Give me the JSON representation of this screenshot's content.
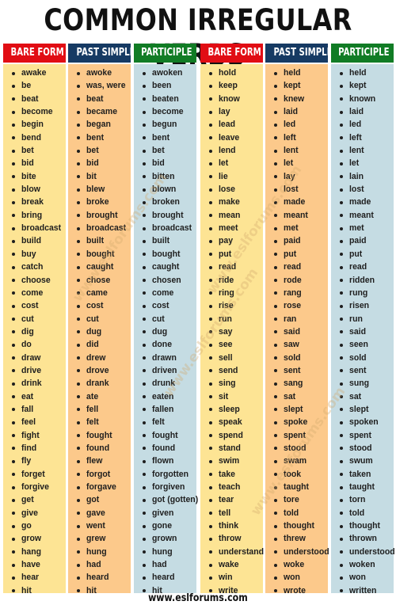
{
  "title": "COMMON IRREGULAR VERBS",
  "footer": "www.eslforums.com",
  "watermark": "www.eslforums.com",
  "colors": {
    "bare_header": "#e10d14",
    "past_header": "#163a63",
    "participle_header": "#117c25",
    "bare_bg": "#fde494",
    "past_bg": "#fcc98b",
    "participle_bg": "#c5dce3"
  },
  "columns": [
    {
      "header": "BARE FORM",
      "items": [
        "awake",
        "be",
        "beat",
        "become",
        "begin",
        "bend",
        "bet",
        "bid",
        "bite",
        "blow",
        "break",
        "bring",
        "broadcast",
        "build",
        "buy",
        "catch",
        "choose",
        "come",
        "cost",
        "cut",
        "dig",
        "do",
        "draw",
        "drive",
        "drink",
        "eat",
        "fall",
        "feel",
        "fight",
        "find",
        "fly",
        "forget",
        "forgive",
        "get",
        "give",
        "go",
        "grow",
        "hang",
        "have",
        "hear",
        "hit"
      ]
    },
    {
      "header": "PAST SIMPLE",
      "items": [
        "awoke",
        "was, were",
        "beat",
        "became",
        "began",
        "bent",
        "bet",
        "bid",
        "bit",
        "blew",
        "broke",
        "brought",
        "broadcast",
        "built",
        "bought",
        "caught",
        "chose",
        "came",
        "cost",
        "cut",
        "dug",
        "did",
        "drew",
        "drove",
        "drank",
        "ate",
        "fell",
        "felt",
        "fought",
        "found",
        "flew",
        "forgot",
        "forgave",
        "got",
        "gave",
        "went",
        "grew",
        "hung",
        "had",
        "heard",
        "hit"
      ]
    },
    {
      "header": "PARTICIPLE",
      "items": [
        "awoken",
        "been",
        "beaten",
        "become",
        "begun",
        "bent",
        "bet",
        "bid",
        "bitten",
        "blown",
        "broken",
        "brought",
        "broadcast",
        "built",
        "bought",
        "caught",
        "chosen",
        "come",
        "cost",
        "cut",
        "dug",
        "done",
        "drawn",
        "driven",
        "drunk",
        "eaten",
        "fallen",
        "felt",
        "fought",
        "found",
        "flown",
        "forgotten",
        "forgiven",
        "got (gotten)",
        "given",
        "gone",
        "grown",
        "hung",
        "had",
        "heard",
        "hit"
      ]
    },
    {
      "header": "BARE FORM",
      "items": [
        "hold",
        "keep",
        "know",
        "lay",
        "lead",
        "leave",
        "lend",
        "let",
        "lie",
        "lose",
        "make",
        "mean",
        "meet",
        "pay",
        "put",
        "read",
        "ride",
        "ring",
        "rise",
        "run",
        "say",
        "see",
        "sell",
        "send",
        "sing",
        "sit",
        "sleep",
        "speak",
        "spend",
        "stand",
        "swim",
        "take",
        "teach",
        "tear",
        "tell",
        "think",
        "throw",
        "understand",
        "wake",
        "win",
        "write"
      ]
    },
    {
      "header": "PAST SIMPLE",
      "items": [
        "held",
        "kept",
        "knew",
        "laid",
        "led",
        "left",
        "lent",
        "let",
        "lay",
        "lost",
        "made",
        "meant",
        "met",
        "paid",
        "put",
        "read",
        "rode",
        "rang",
        "rose",
        "ran",
        "said",
        "saw",
        "sold",
        "sent",
        "sang",
        "sat",
        "slept",
        "spoke",
        "spent",
        "stood",
        "swam",
        "took",
        "taught",
        "tore",
        "told",
        "thought",
        "threw",
        "understood",
        "woke",
        "won",
        "wrote"
      ]
    },
    {
      "header": "PARTICIPLE",
      "items": [
        "held",
        "kept",
        "known",
        "laid",
        "led",
        "left",
        "lent",
        "let",
        "lain",
        "lost",
        "made",
        "meant",
        "met",
        "paid",
        "put",
        "read",
        "ridden",
        "rung",
        "risen",
        "run",
        "said",
        "seen",
        "sold",
        "sent",
        "sung",
        "sat",
        "slept",
        "spoken",
        "spent",
        "stood",
        "swum",
        "taken",
        "taught",
        "torn",
        "told",
        "thought",
        "thrown",
        "understood",
        "woken",
        "won",
        "written"
      ]
    }
  ]
}
